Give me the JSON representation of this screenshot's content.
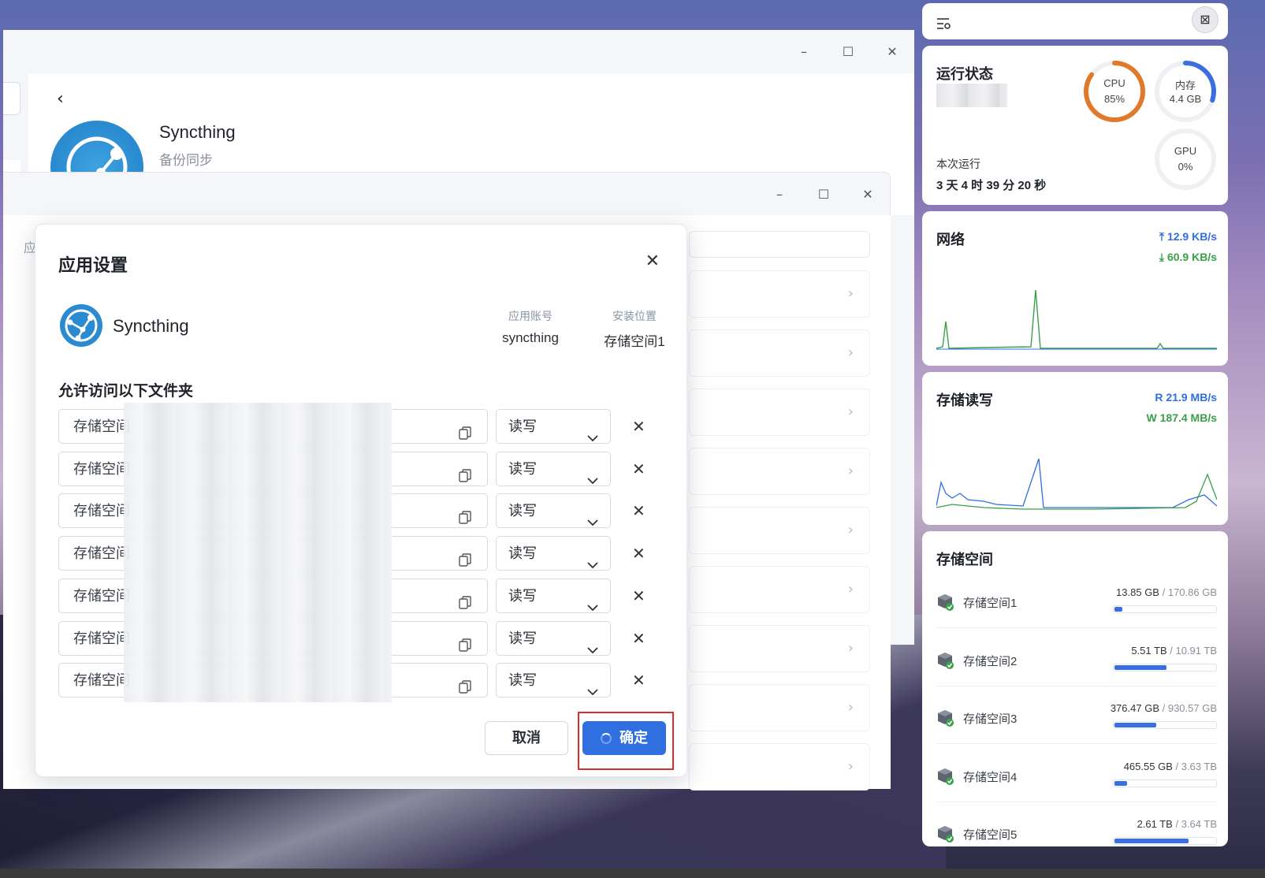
{
  "window_back": {
    "app_name": "Syncthing",
    "app_subtitle": "备份同步"
  },
  "window_mid": {
    "section_label": "应"
  },
  "dialog": {
    "title": "应用设置",
    "app_name": "Syncthing",
    "account_key": "应用账号",
    "account_value": "syncthing",
    "location_key": "安装位置",
    "location_value": "存储空间1",
    "section_title": "允许访问以下文件夹",
    "folders": [
      {
        "path": "存储空间",
        "permission": "读写"
      },
      {
        "path": "存储空间",
        "permission": "读写"
      },
      {
        "path": "存储空间",
        "permission": "读写"
      },
      {
        "path": "存储空间",
        "permission": "读写"
      },
      {
        "path": "存储空间",
        "permission": "读写"
      },
      {
        "path": "存储空间",
        "permission": "读写"
      },
      {
        "path": "存储空间",
        "permission": "读写"
      }
    ],
    "cancel_label": "取消",
    "confirm_label": "确定"
  },
  "sidebar": {
    "status": {
      "title": "运行状态",
      "cpu_label": "CPU",
      "cpu_value": "85%",
      "cpu_fraction": 0.85,
      "mem_label": "内存",
      "mem_value": "4.4 GB",
      "mem_fraction": 0.3,
      "gpu_label": "GPU",
      "gpu_value": "0%",
      "gpu_fraction": 0.0,
      "uptime_label": "本次运行",
      "uptime_value": "3 天 4 时 39 分 20 秒"
    },
    "network": {
      "title": "网络",
      "upload": "12.9 KB/s",
      "download": "60.9 KB/s"
    },
    "disk_io": {
      "title": "存储读写",
      "read": "R   21.9 MB/s",
      "write": "W  187.4 MB/s"
    },
    "storage": {
      "title": "存储空间",
      "items": [
        {
          "name": "存储空间1",
          "used": "13.85 GB",
          "total": "/ 170.86 GB",
          "fraction": 0.08
        },
        {
          "name": "存储空间2",
          "used": "5.51 TB",
          "total": "/ 10.91 TB",
          "fraction": 0.505
        },
        {
          "name": "存储空间3",
          "used": "376.47 GB",
          "total": "/ 930.57 GB",
          "fraction": 0.405
        },
        {
          "name": "存储空间4",
          "used": "465.55 GB",
          "total": "/ 3.63 TB",
          "fraction": 0.125
        },
        {
          "name": "存储空间5",
          "used": "2.61 TB",
          "total": "/ 3.64 TB",
          "fraction": 0.72
        }
      ]
    }
  },
  "colors": {
    "accent": "#2f6fe0",
    "cpu_ring": "#e07a2a",
    "mem_ring": "#3b6fe0",
    "upload": "#2f6fe0",
    "download": "#3aa04a",
    "highlight_box": "#e02b2b"
  }
}
